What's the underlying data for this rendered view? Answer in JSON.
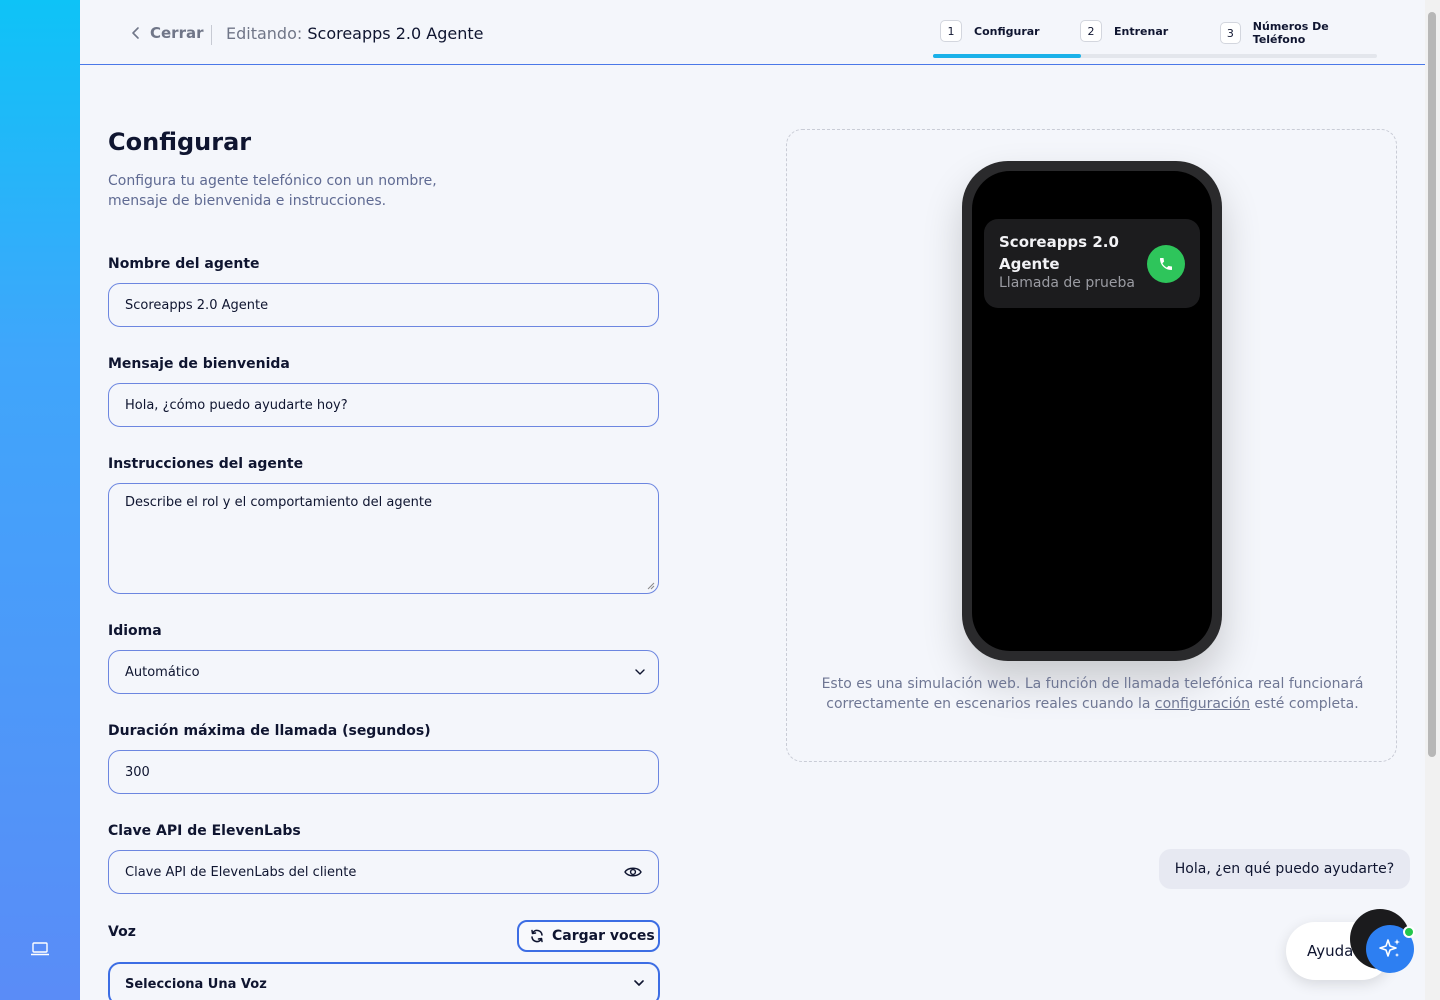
{
  "header": {
    "back_label": "Cerrar",
    "editing_prefix": "Editando:",
    "agent_name": "Scoreapps 2.0 Agente",
    "steps": [
      {
        "num": "1",
        "label": "Configurar"
      },
      {
        "num": "2",
        "label": "Entrenar"
      },
      {
        "num": "3",
        "label": "Números De Teléfono"
      }
    ],
    "progress_fraction": 0.333
  },
  "form": {
    "title": "Configurar",
    "description": "Configura tu agente telefónico con un nombre, mensaje de bienvenida e instrucciones.",
    "name_label": "Nombre del agente",
    "name_value": "Scoreapps 2.0 Agente",
    "welcome_label": "Mensaje de bienvenida",
    "welcome_value": "Hola, ¿cómo puedo ayudarte hoy?",
    "instructions_label": "Instrucciones del agente",
    "instructions_placeholder": "Describe el rol y el comportamiento del agente",
    "language_label": "Idioma",
    "language_value": "Automático",
    "duration_label": "Duración máxima de llamada (segundos)",
    "duration_value": "300",
    "apikey_label": "Clave API de ElevenLabs",
    "apikey_placeholder": "Clave API de ElevenLabs del cliente",
    "voice_label": "Voz",
    "load_voices_label": "Cargar voces",
    "voice_value": "Selecciona Una Voz"
  },
  "preview": {
    "call_name": "Scoreapps 2.0 Agente",
    "call_sub": "Llamada de prueba",
    "note_before": "Esto es una simulación web. La función de llamada telefónica real funcionará correctamente en escenarios reales cuando la",
    "note_link": "configuración",
    "note_after": "esté completa."
  },
  "chat": {
    "bubble_text": "Hola, ¿en qué puedo ayudarte?",
    "help_label": "Ayuda"
  },
  "colors": {
    "accent": "#3c6de4",
    "progress": "#1ab1e9",
    "call_green": "#2ec55b",
    "status_green": "#24c64b",
    "ai_blue": "#2d7ff2"
  },
  "icons": [
    "chevron-left-icon",
    "laptop-icon",
    "chevron-down-icon",
    "eye-icon",
    "refresh-icon",
    "phone-icon",
    "sparkles-icon"
  ]
}
